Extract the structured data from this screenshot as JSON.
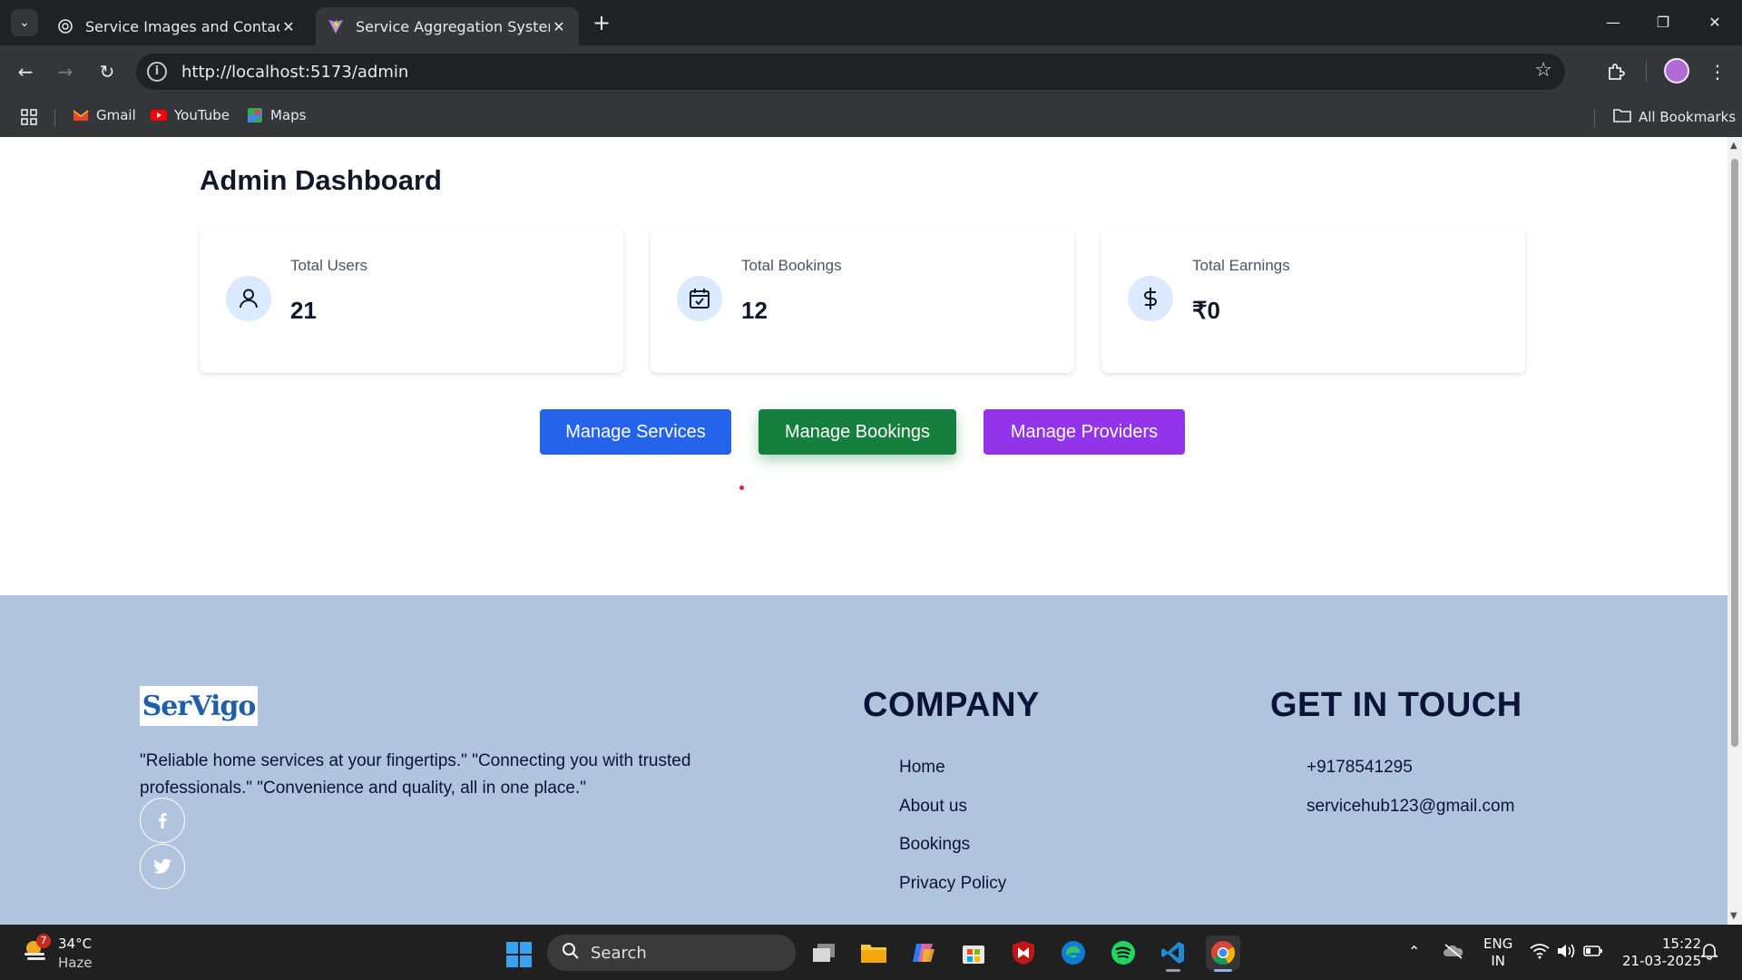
{
  "browser": {
    "tabs": [
      {
        "title": "Service Images and Contact",
        "active": false,
        "icon": "openai-icon"
      },
      {
        "title": "Service Aggregation System",
        "active": true,
        "icon": "vite-icon"
      }
    ],
    "url": "http://localhost:5173/admin",
    "bookmarks": [
      {
        "label": "Gmail",
        "icon": "gmail-icon"
      },
      {
        "label": "YouTube",
        "icon": "youtube-icon"
      },
      {
        "label": "Maps",
        "icon": "maps-icon"
      }
    ],
    "all_bookmarks": "All Bookmarks"
  },
  "dashboard": {
    "title": "Admin Dashboard",
    "stats": [
      {
        "label": "Total Users",
        "value": "21",
        "icon": "user-icon"
      },
      {
        "label": "Total Bookings",
        "value": "12",
        "icon": "calendar-check-icon"
      },
      {
        "label": "Total Earnings",
        "value": "₹0",
        "icon": "dollar-icon"
      }
    ],
    "buttons": {
      "services": "Manage Services",
      "bookings": "Manage Bookings",
      "providers": "Manage Providers"
    },
    "colors": {
      "blue": "#2563eb",
      "green": "#15803d",
      "purple": "#9333ea"
    }
  },
  "footer": {
    "logo": "SerVigo",
    "tagline": "\"Reliable home services at your fingertips.\" \"Connecting you with trusted professionals.\" \"Convenience and quality, all in one place.\"",
    "company_heading": "COMPANY",
    "company_links": [
      "Home",
      "About us",
      "Bookings",
      "Privacy Policy"
    ],
    "contact_heading": "GET IN TOUCH",
    "phone": "+9178541295",
    "email": "servicehub123@gmail.com",
    "background": "#b0c4de"
  },
  "taskbar": {
    "weather": {
      "badge": "7",
      "temp": "34°C",
      "condition": "Haze"
    },
    "search": "Search",
    "lang": {
      "line1": "ENG",
      "line2": "IN"
    },
    "time": "15:22",
    "date": "21-03-2025"
  }
}
